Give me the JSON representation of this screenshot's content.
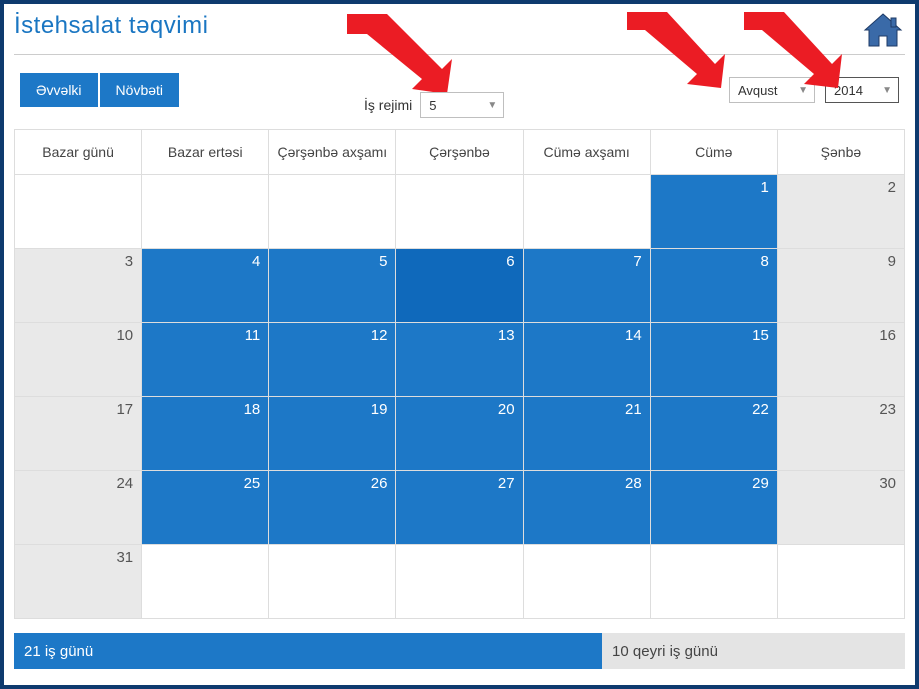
{
  "title": "İstehsalat təqvimi",
  "nav": {
    "prev": "Əvvəlki",
    "next": "Növbəti"
  },
  "mode": {
    "label": "İş rejimi",
    "value": "5"
  },
  "month": {
    "value": "Avqust"
  },
  "year": {
    "value": "2014"
  },
  "weekdays": [
    "Bazar günü",
    "Bazar ertəsi",
    "Çərşənbə axşamı",
    "Çərşənbə",
    "Cümə axşamı",
    "Cümə",
    "Şənbə"
  ],
  "cells": [
    [
      {
        "t": ""
      },
      {
        "t": ""
      },
      {
        "t": ""
      },
      {
        "t": ""
      },
      {
        "t": ""
      },
      {
        "t": "1",
        "c": "blue"
      },
      {
        "t": "2",
        "c": "grey"
      }
    ],
    [
      {
        "t": "3",
        "c": "grey"
      },
      {
        "t": "4",
        "c": "blue"
      },
      {
        "t": "5",
        "c": "blue"
      },
      {
        "t": "6",
        "c": "blue-dark"
      },
      {
        "t": "7",
        "c": "blue"
      },
      {
        "t": "8",
        "c": "blue"
      },
      {
        "t": "9",
        "c": "grey"
      }
    ],
    [
      {
        "t": "10",
        "c": "grey"
      },
      {
        "t": "11",
        "c": "blue"
      },
      {
        "t": "12",
        "c": "blue"
      },
      {
        "t": "13",
        "c": "blue"
      },
      {
        "t": "14",
        "c": "blue"
      },
      {
        "t": "15",
        "c": "blue"
      },
      {
        "t": "16",
        "c": "grey"
      }
    ],
    [
      {
        "t": "17",
        "c": "grey"
      },
      {
        "t": "18",
        "c": "blue"
      },
      {
        "t": "19",
        "c": "blue"
      },
      {
        "t": "20",
        "c": "blue"
      },
      {
        "t": "21",
        "c": "blue"
      },
      {
        "t": "22",
        "c": "blue"
      },
      {
        "t": "23",
        "c": "grey"
      }
    ],
    [
      {
        "t": "24",
        "c": "grey"
      },
      {
        "t": "25",
        "c": "blue"
      },
      {
        "t": "26",
        "c": "blue"
      },
      {
        "t": "27",
        "c": "blue"
      },
      {
        "t": "28",
        "c": "blue"
      },
      {
        "t": "29",
        "c": "blue"
      },
      {
        "t": "30",
        "c": "grey"
      }
    ],
    [
      {
        "t": "31",
        "c": "grey"
      },
      {
        "t": ""
      },
      {
        "t": ""
      },
      {
        "t": ""
      },
      {
        "t": ""
      },
      {
        "t": ""
      },
      {
        "t": ""
      }
    ]
  ],
  "footer": {
    "work": "21 iş günü",
    "nonwork": "10 qeyri iş günü"
  }
}
